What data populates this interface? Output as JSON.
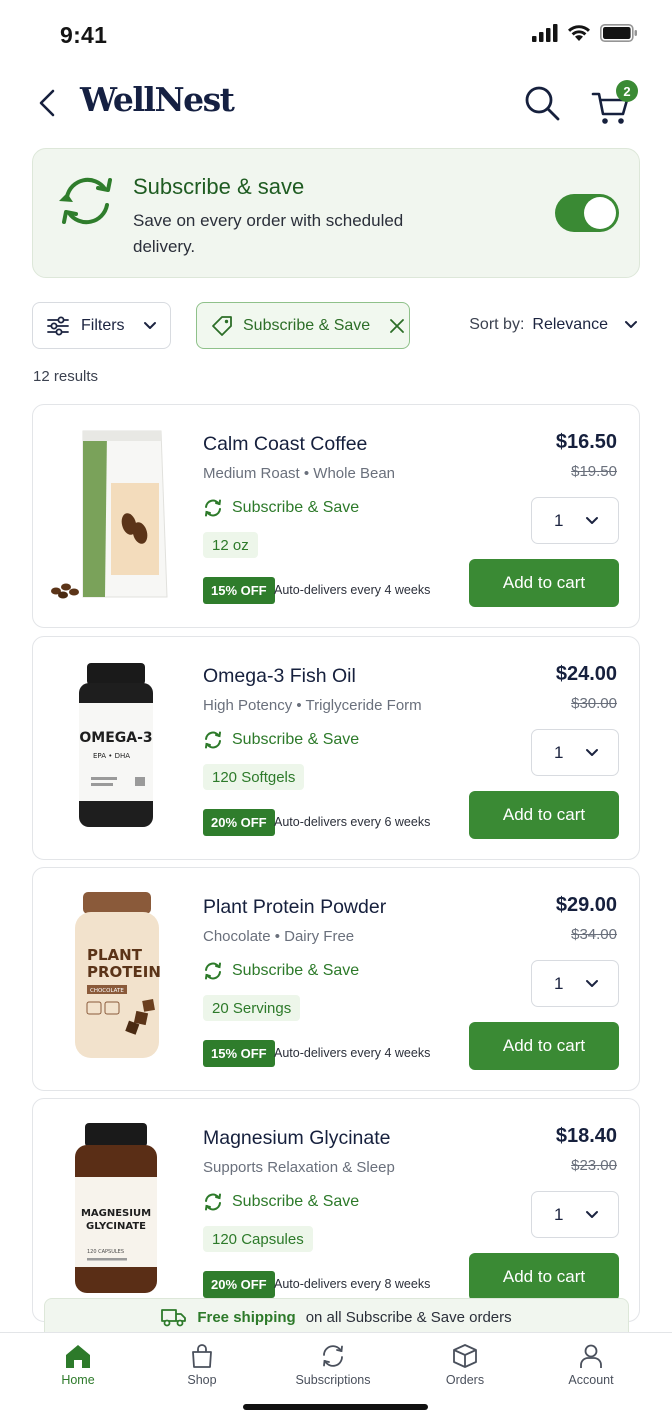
{
  "status": {
    "time": "9:41"
  },
  "header": {
    "brand": "WellNest",
    "cart_count": "2"
  },
  "banner": {
    "title": "Subscribe & save",
    "description": "Save on every order with scheduled delivery.",
    "toggle_on": true
  },
  "filters": {
    "filters_label": "Filters",
    "chip_label": "Subscribe & Save",
    "sort_label": "Sort by:",
    "sort_value": "Relevance",
    "results": "12 results"
  },
  "products": [
    {
      "name": "Calm Coast Coffee",
      "subtitle": "Medium Roast • Whole Bean",
      "save_label": "Subscribe & Save",
      "size": "12 oz",
      "discount": "15% OFF",
      "frequency": "Auto-delivers every 4 weeks",
      "price": "$16.50",
      "old_price": "$19.50",
      "qty": "1",
      "cta": "Add to cart"
    },
    {
      "name": "Omega-3 Fish Oil",
      "subtitle": "High Potency • Triglyceride Form",
      "save_label": "Subscribe & Save",
      "size": "120 Softgels",
      "discount": "20% OFF",
      "frequency": "Auto-delivers every 6 weeks",
      "price": "$24.00",
      "old_price": "$30.00",
      "qty": "1",
      "cta": "Add to cart",
      "label_main": "OMEGA-3",
      "label_sub": "EPA • DHA"
    },
    {
      "name": "Plant Protein Powder",
      "subtitle": "Chocolate • Dairy Free",
      "save_label": "Subscribe & Save",
      "size": "20 Servings",
      "discount": "15% OFF",
      "frequency": "Auto-delivers every 4 weeks",
      "price": "$29.00",
      "old_price": "$34.00",
      "qty": "1",
      "cta": "Add to cart",
      "label_main1": "PLANT",
      "label_main2": "PROTEIN",
      "label_sub": "CHOCOLATE"
    },
    {
      "name": "Magnesium Glycinate",
      "subtitle": "Supports Relaxation & Sleep",
      "save_label": "Subscribe & Save",
      "size": "120 Capsules",
      "discount": "20% OFF",
      "frequency": "Auto-delivers every 8 weeks",
      "price": "$18.40",
      "old_price": "$23.00",
      "qty": "1",
      "cta": "Add to cart",
      "label_main1": "MAGNESIUM",
      "label_main2": "GLYCINATE",
      "label_sub": "120 CAPSULES"
    }
  ],
  "shipping": {
    "highlight": "Free shipping",
    "rest": "on all Subscribe & Save orders"
  },
  "nav": [
    {
      "label": "Home"
    },
    {
      "label": "Shop"
    },
    {
      "label": "Subscriptions"
    },
    {
      "label": "Orders"
    },
    {
      "label": "Account"
    }
  ],
  "colors": {
    "accent": "#3a8a34",
    "navy": "#16203d",
    "banner_bg": "#f1f6ef"
  }
}
